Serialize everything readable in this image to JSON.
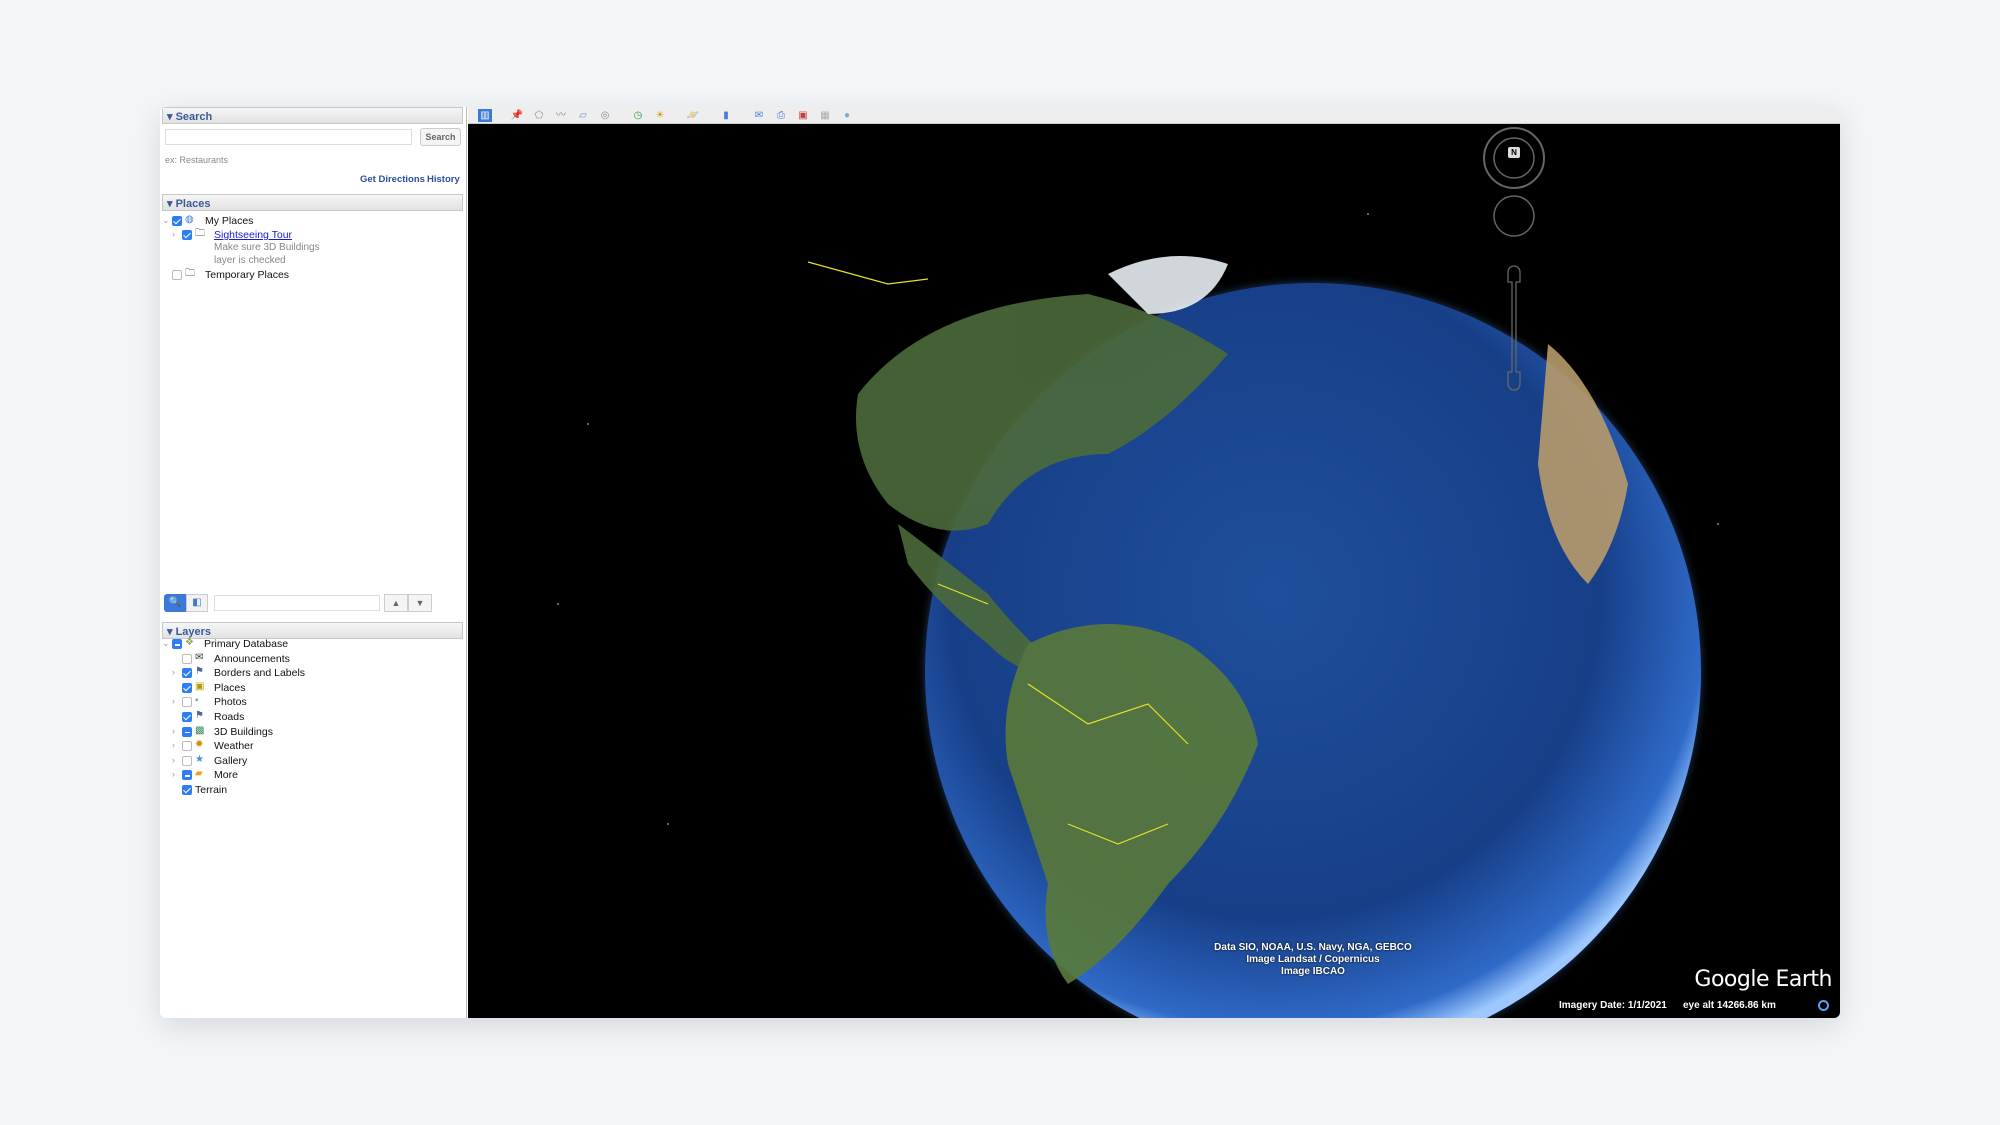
{
  "search": {
    "header": "Search",
    "input_value": "",
    "button": "Search",
    "hint": "ex: Restaurants",
    "get_directions": "Get Directions",
    "history": "History"
  },
  "places": {
    "header": "Places",
    "items": [
      {
        "label": "My Places",
        "checked": "on",
        "icon": "my-places-icon"
      },
      {
        "label": "Sightseeing Tour",
        "checked": "on",
        "icon": "folder-icon",
        "desc1": "Make sure 3D Buildings",
        "desc2": "layer is checked"
      },
      {
        "label": "Temporary Places",
        "checked": "off",
        "icon": "folder-icon"
      }
    ]
  },
  "layers": {
    "header": "Layers",
    "items": [
      {
        "label": "Primary Database",
        "state": "mixed"
      },
      {
        "label": "Announcements",
        "state": "off"
      },
      {
        "label": "Borders and Labels",
        "state": "on"
      },
      {
        "label": "Places",
        "state": "on"
      },
      {
        "label": "Photos",
        "state": "off"
      },
      {
        "label": "Roads",
        "state": "on"
      },
      {
        "label": "3D Buildings",
        "state": "mixed"
      },
      {
        "label": "Weather",
        "state": "off"
      },
      {
        "label": "Gallery",
        "state": "off"
      },
      {
        "label": "More",
        "state": "mixed"
      },
      {
        "label": "Terrain",
        "state": "on"
      }
    ]
  },
  "map": {
    "attribution1": "Data SIO, NOAA, U.S. Navy, NGA, GEBCO",
    "attribution2": "Image Landsat / Copernicus",
    "attribution3": "Image IBCAO",
    "logo": "Google Earth",
    "imagery_date": "Imagery Date: 1/1/2021",
    "eye_alt": "eye alt 14266.86 km",
    "compass_label": "N"
  },
  "colors": {
    "accent": "#2f7df6",
    "header_text": "#3a5a9a",
    "link": "#1a1ad0"
  }
}
